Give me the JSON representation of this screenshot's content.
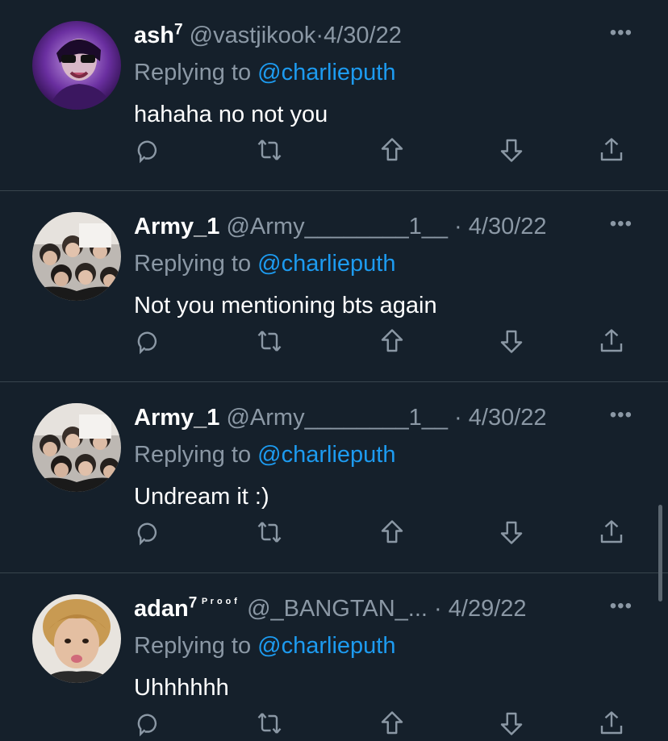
{
  "tweets": [
    {
      "name": "ash",
      "name_sup": "7",
      "name_extra": "",
      "handle": "@vastjikook",
      "separator": "·",
      "date": "4/30/22",
      "replying_prefix": "Replying to ",
      "replying_mention": "@charlieputh",
      "text": "hahaha no not you"
    },
    {
      "name": "Army_1",
      "name_sup": "",
      "name_extra": "",
      "handle": "@Army________1__",
      "separator": "·",
      "date": "4/30/22",
      "replying_prefix": "Replying to ",
      "replying_mention": "@charlieputh",
      "text": "Not you mentioning bts again"
    },
    {
      "name": "Army_1",
      "name_sup": "",
      "name_extra": "",
      "handle": "@Army________1__",
      "separator": "·",
      "date": "4/30/22",
      "replying_prefix": "Replying to ",
      "replying_mention": "@charlieputh",
      "text": "Undream it :)"
    },
    {
      "name": "adan",
      "name_sup": "7",
      "name_extra": "ᴾʳᵒᵒᶠ",
      "handle": "@_BANGTAN_...",
      "separator": "·",
      "date": "4/29/22",
      "replying_prefix": "Replying to ",
      "replying_mention": "@charlieputh",
      "text": "Uhhhhhh"
    }
  ],
  "icons": {
    "more": "more-icon",
    "reply": "reply-icon",
    "retweet": "retweet-icon",
    "upvote": "upvote-icon",
    "downvote": "downvote-icon",
    "share": "share-icon"
  },
  "colors": {
    "background": "#15202b",
    "secondary_text": "#8b98a5",
    "mention": "#1d9bf0",
    "divider": "#38444d"
  }
}
